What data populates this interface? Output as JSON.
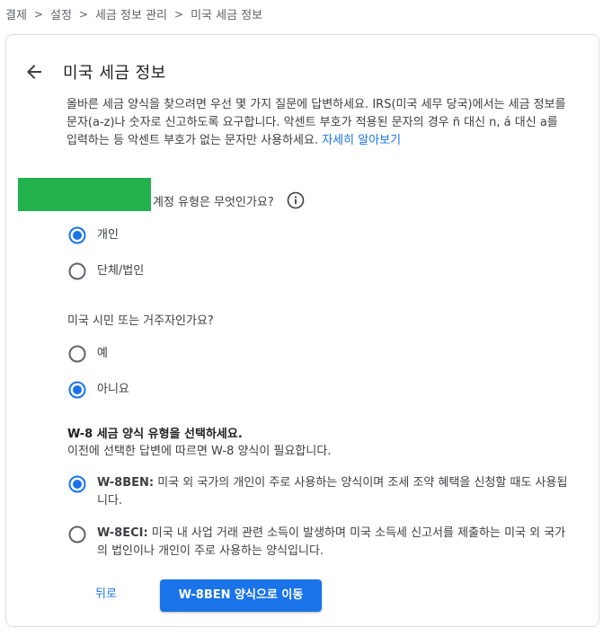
{
  "breadcrumb": {
    "items": [
      "결제",
      "설정",
      "세금 정보 관리",
      "미국 세금 정보"
    ],
    "separator": ">"
  },
  "header": {
    "title": "미국 세금 정보",
    "back_icon": "arrow-back-icon"
  },
  "intro": {
    "text": "올바른 세금 양식을 찾으려면 우선 몇 가지 질문에 답변하세요. IRS(미국 세무 당국)에서는 세금 정보를 문자(a-z)나 숫자로 신고하도록 요구합니다. 악센트 부호가 적용된 문자의 경우 ñ 대신 n, á 대신 a를 입력하는 등 악센트 부호가 없는 문자만 사용하세요. ",
    "link": "자세히 알아보기"
  },
  "account_type": {
    "question": "계정 유형은 무엇인가요?",
    "info_icon": "info-icon",
    "options": [
      {
        "label": "개인",
        "selected": true
      },
      {
        "label": "단체/법인",
        "selected": false
      }
    ]
  },
  "us_person": {
    "question": "미국 시민 또는 거주자인가요?",
    "options": [
      {
        "label": "예",
        "selected": false
      },
      {
        "label": "아니요",
        "selected": true
      }
    ]
  },
  "w8_form": {
    "title": "W-8 세금 양식 유형을 선택하세요.",
    "subtitle": "이전에 선택한 답변에 따르면 W-8 양식이 필요합니다.",
    "options": [
      {
        "code": "W-8BEN:",
        "description": " 미국 외 국가의 개인이 주로 사용하는 양식이며 조세 조약 혜택을 신청할 때도 사용됩니다.",
        "selected": true
      },
      {
        "code": "W-8ECI:",
        "description": " 미국 내 사업 거래 관련 소득이 발생하며 미국 소득세 신고서를 제출하는 미국 외 국가의 법인이나 개인이 주로 사용하는 양식입니다.",
        "selected": false
      }
    ]
  },
  "actions": {
    "back_label": "뒤로",
    "primary_label": "W-8BEN 양식으로 이동"
  },
  "colors": {
    "accent": "#1a73e8",
    "redaction": "#22b14c",
    "text": "#3c4043",
    "radio_unselected": "#5f6368"
  }
}
